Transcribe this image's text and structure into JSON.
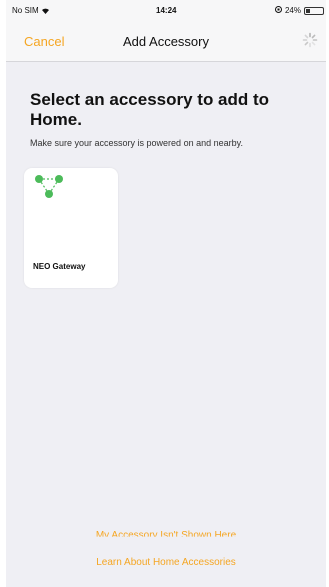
{
  "status_bar": {
    "carrier": "No SIM",
    "time": "14:24",
    "battery": "24%"
  },
  "nav": {
    "cancel_label": "Cancel",
    "title": "Add Accessory"
  },
  "content": {
    "heading": "Select an accessory to add to Home.",
    "subtext": "Make sure your accessory is powered on and nearby."
  },
  "accessories": [
    {
      "name": "NEO Gateway",
      "icon": "network-nodes-icon",
      "icon_color": "#4cbb5a"
    }
  ],
  "footer": {
    "not_shown_link": "My Accessory Isn't Shown Here",
    "learn_link": "Learn About Home Accessories"
  },
  "colors": {
    "accent": "#f5a623",
    "background": "#efeff4"
  }
}
